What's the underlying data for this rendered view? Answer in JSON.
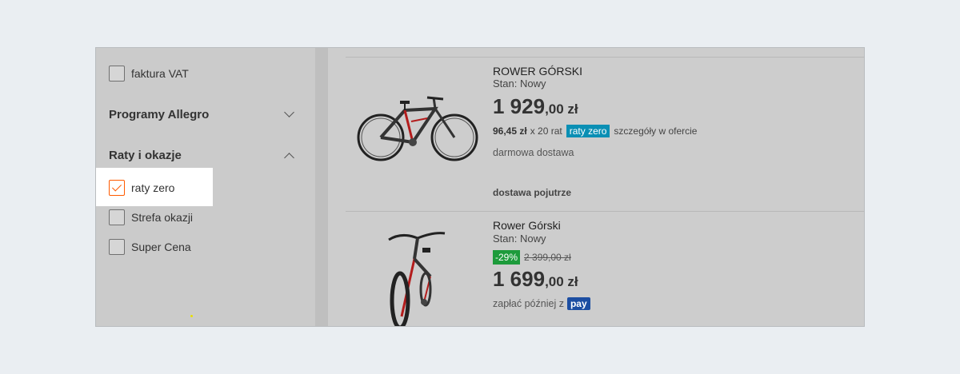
{
  "sidebar": {
    "invoice_checkbox": {
      "label": "faktura VAT",
      "checked": false
    },
    "section_programs": {
      "title": "Programy Allegro",
      "expanded": false
    },
    "section_installments": {
      "title": "Raty i okazje",
      "expanded": true
    },
    "options": [
      {
        "label": "raty zero",
        "checked": true
      },
      {
        "label": "Strefa okazji",
        "checked": false
      },
      {
        "label": "Super Cena",
        "checked": false
      }
    ]
  },
  "products": [
    {
      "title": "ROWER GÓRSKI",
      "condition": "Stan: Nowy",
      "price_int": "1 929",
      "price_dec": ",00 zł",
      "installment_amount": "96,45 zł",
      "installment_count": "x 20 rat",
      "installment_badge": "raty zero",
      "installment_details": "szczegóły w ofercie",
      "shipping": "darmowa dostawa",
      "delivery": "dostawa pojutrze"
    },
    {
      "title": "Rower Górski",
      "condition": "Stan: Nowy",
      "discount": "-29%",
      "old_price": "2 399,00 zł",
      "price_int": "1 699",
      "price_dec": ",00 zł",
      "pay_later": "zapłać później z",
      "pay_logo": "pay"
    }
  ],
  "colors": {
    "accent": "#ff5a00",
    "badge_blue": "#0a8fb4",
    "badge_green": "#1d9b3b",
    "pay_blue": "#1c4ea2"
  }
}
